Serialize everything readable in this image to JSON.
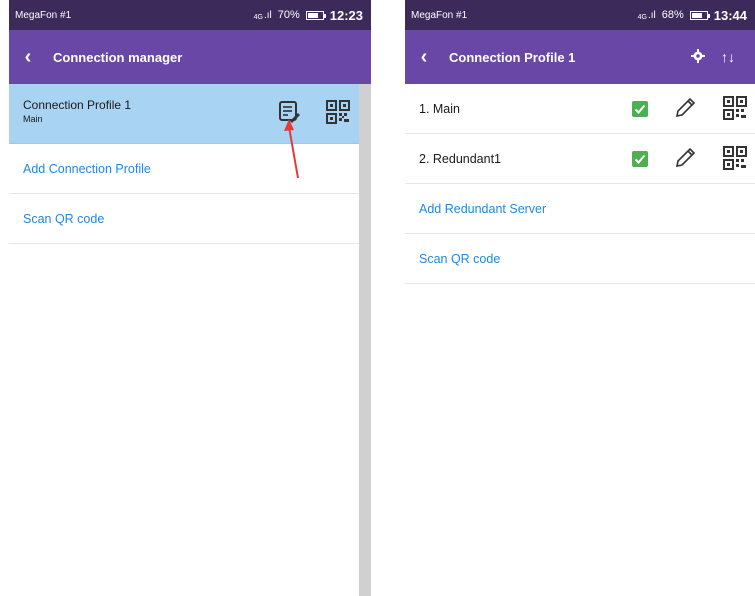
{
  "left": {
    "status": {
      "carrier": "MegaFon #1",
      "net": "4G",
      "battery": "70%",
      "time": "12:23"
    },
    "appbar": {
      "title": "Connection manager"
    },
    "profile": {
      "name": "Connection Profile 1",
      "sub": "Main"
    },
    "links": [
      "Add Connection Profile",
      "Scan QR code"
    ]
  },
  "right": {
    "status": {
      "carrier": "MegaFon #1",
      "net": "4G",
      "battery": "68%",
      "time": "13:44"
    },
    "appbar": {
      "title": "Connection Profile 1"
    },
    "servers": [
      "1. Main",
      "2. Redundant1"
    ],
    "links": [
      "Add Redundant Server",
      "Scan QR code"
    ]
  },
  "colors": {
    "statusbar": "#3b2a5a",
    "appbar": "#6847a6",
    "selected": "#a9d3f2",
    "link": "#1e88e5",
    "check": "#4caf50",
    "annotation": "#e53935"
  }
}
